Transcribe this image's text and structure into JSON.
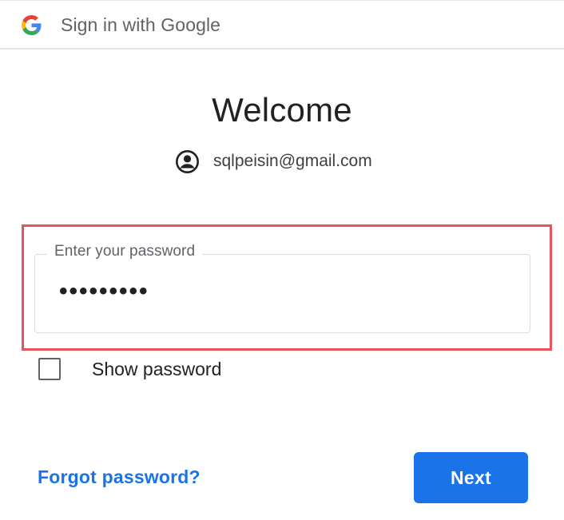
{
  "header": {
    "logo_icon": "google-g-icon",
    "title": "Sign in with Google"
  },
  "main": {
    "heading": "Welcome",
    "account": {
      "icon": "account-circle-icon",
      "email": "sqlpeisin@gmail.com"
    },
    "password": {
      "label": "Enter your password",
      "masked_value": "•••••••••",
      "highlight_color": "#e8545e"
    },
    "show_password": {
      "label": "Show password",
      "checked": false
    }
  },
  "actions": {
    "forgot_label": "Forgot password?",
    "next_label": "Next"
  },
  "colors": {
    "accent": "#1a73e8",
    "text_primary": "#202124",
    "text_secondary": "#5f6368",
    "field_border": "#dadce0"
  }
}
